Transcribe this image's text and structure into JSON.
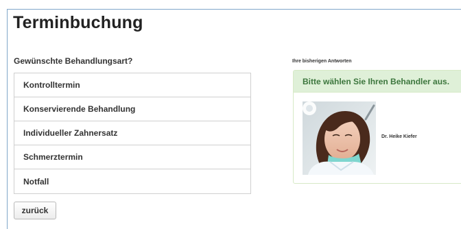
{
  "page": {
    "title": "Terminbuchung"
  },
  "question": {
    "label": "Gewünschte Behandlungsart?",
    "options": [
      "Kontrolltermin",
      "Konservierende Behandlung",
      "Individueller Zahnersatz",
      "Schmerztermin",
      "Notfall"
    ]
  },
  "back_button": {
    "label": "zurück"
  },
  "answers": {
    "label": "Ihre bisherigen Antworten",
    "panel_heading": "Bitte wählen Sie Ihren Behandler aus.",
    "doctor": {
      "name": "Dr. Heike Kiefer",
      "photo": "dentist-portrait"
    }
  },
  "colors": {
    "frame_border": "#7fa6c9",
    "panel_heading_bg": "#dff0d8",
    "panel_heading_text": "#3c763d",
    "panel_border": "#d6e9c6"
  }
}
